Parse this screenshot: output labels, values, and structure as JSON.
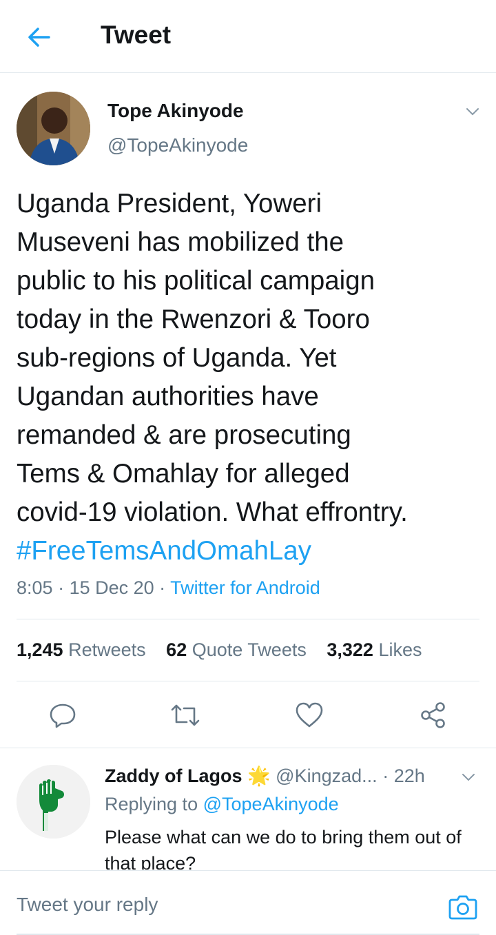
{
  "header": {
    "title": "Tweet",
    "back_icon": "arrow-left-icon"
  },
  "tweet": {
    "author_name": "Tope Akinyode",
    "author_handle": "@TopeAkinyode",
    "text": "Uganda President, Yoweri\nMuseveni has mobilized the\npublic to his political campaign\ntoday in the Rwenzori & Tooro\nsub-regions of Uganda. Yet\nUgandan authorities have\nremanded & are prosecuting\nTems & Omahlay for alleged\ncovid-19 violation. What effrontry.",
    "hashtag": "#FreeTemsAndOmahLay",
    "time": "8:05",
    "date": "15 Dec 20",
    "source": "Twitter for Android",
    "retweets_count": "1,245",
    "retweets_label": "Retweets",
    "quotes_count": "62",
    "quotes_label": "Quote Tweets",
    "likes_count": "3,322",
    "likes_label": "Likes"
  },
  "actions": [
    "reply-icon",
    "retweet-icon",
    "like-icon",
    "share-icon"
  ],
  "reply": {
    "name": "Zaddy of Lagos",
    "badge": "🌟",
    "handle": "@Kingzad...",
    "time": "22h",
    "replying_prefix": "Replying to",
    "replying_to": "@TopeAkinyode",
    "text": "Please what can we do to bring them out of that place?"
  },
  "compose": {
    "placeholder": "Tweet your reply",
    "camera_icon": "camera-icon"
  },
  "colors": {
    "accent": "#1da1f2",
    "text": "#14171a",
    "secondary": "#657786",
    "border": "#e1e8ed"
  }
}
